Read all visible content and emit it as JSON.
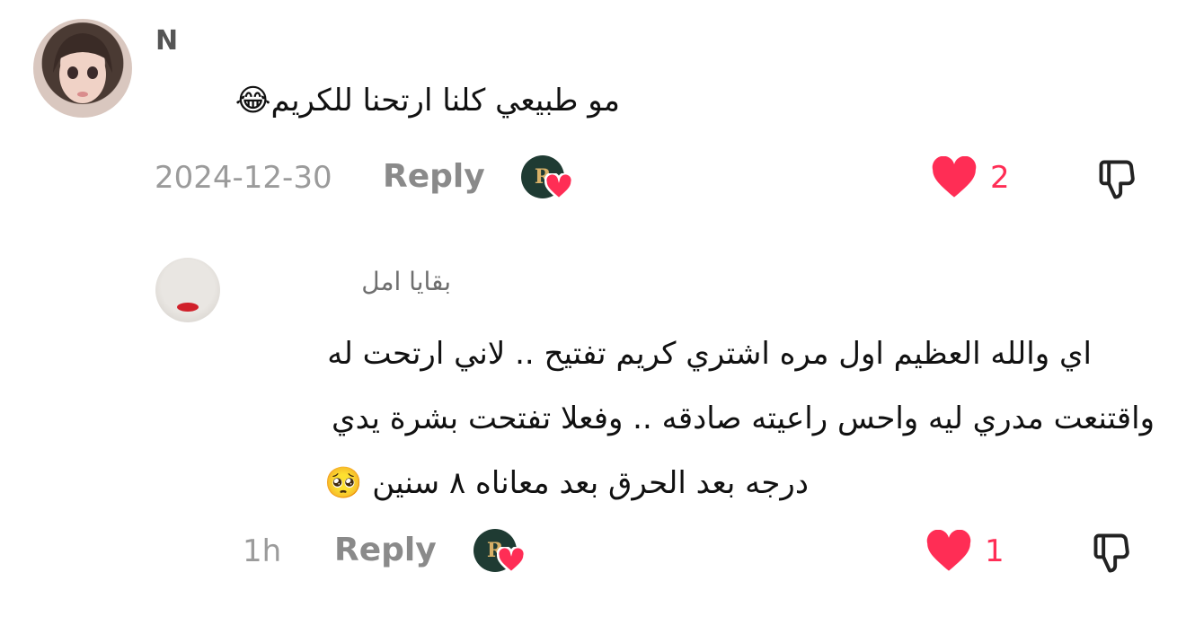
{
  "comments": [
    {
      "username": "N",
      "text_lines": [
        "مو طبيعي كلنا ارتحنا للكريم😂"
      ],
      "timestamp": "2024-12-30",
      "reply_label": "Reply",
      "creator_badge_letter": "R",
      "likes": "2"
    },
    {
      "username": "بقايا امل",
      "text_lines": [
        "اي والله العظيم اول مره اشتري كريم تفتيح .. لاني ارتحت له",
        "واقتنعت مدري ليه واحس راعيته صادقه .. وفعلا تفتحت بشرة يدي",
        "درجه بعد الحرق بعد معاناه ٨ سنين 🥺"
      ],
      "timestamp": "1h",
      "reply_label": "Reply",
      "creator_badge_letter": "R",
      "likes": "1"
    }
  ],
  "colors": {
    "like": "#ff2d55",
    "badge_bg": "#1f3b33",
    "muted": "#9b9b9b"
  },
  "icons": {
    "like": "heart-icon",
    "dislike": "thumbs-down-icon",
    "creator": "creator-liked-badge"
  }
}
